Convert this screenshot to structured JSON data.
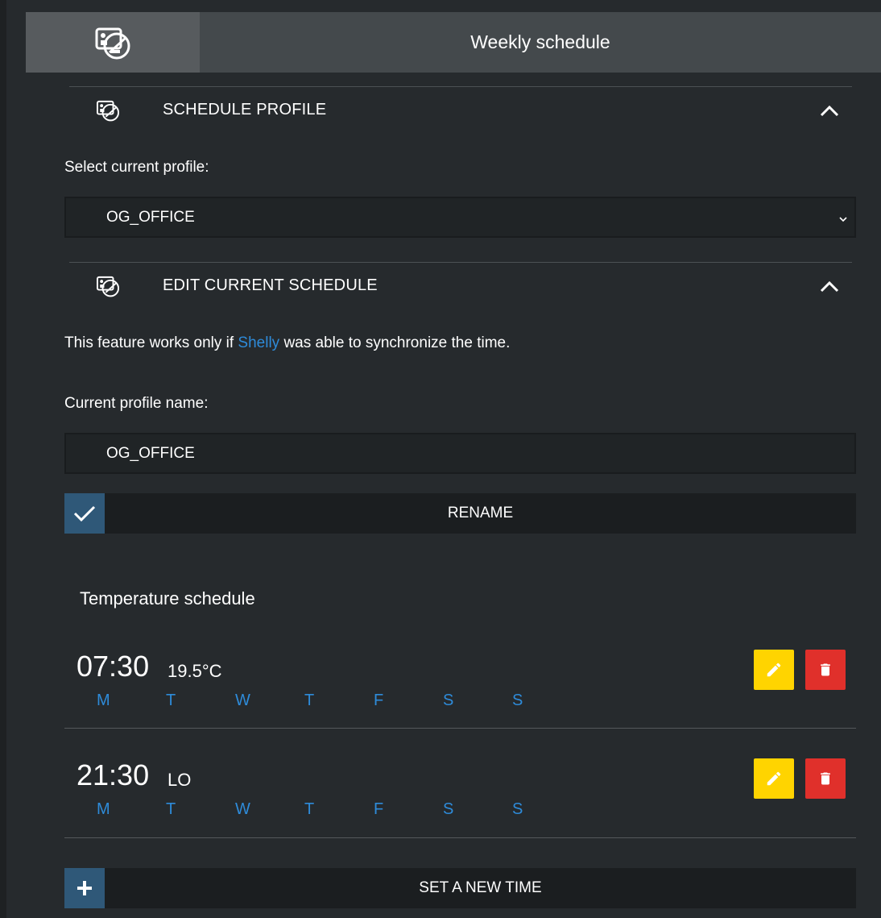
{
  "header": {
    "title": "Weekly schedule",
    "icon": "schedule-app-icon"
  },
  "schedule_profile": {
    "title": "SCHEDULE PROFILE",
    "select_label": "Select current profile:",
    "selected_profile": "OG_OFFICE"
  },
  "edit_schedule": {
    "title": "EDIT CURRENT SCHEDULE",
    "info_prefix": "This feature works only if ",
    "info_link": "Shelly",
    "info_suffix": " was able to synchronize the time.",
    "name_label": "Current profile name:",
    "name_value": "OG_OFFICE",
    "rename_label": "RENAME"
  },
  "temperature_schedule": {
    "title": "Temperature schedule",
    "entries": [
      {
        "time": "07:30",
        "value": "19.5°C",
        "days": [
          "M",
          "T",
          "W",
          "T",
          "F",
          "S",
          "S"
        ]
      },
      {
        "time": "21:30",
        "value": "LO",
        "days": [
          "M",
          "T",
          "W",
          "T",
          "F",
          "S",
          "S"
        ]
      }
    ],
    "new_time_label": "SET A NEW TIME"
  },
  "colors": {
    "background": "#262a2d",
    "accent_blue": "#2e8bd9",
    "edit_yellow": "#ffd400",
    "delete_red": "#e0302b",
    "icon_button_blue": "#2f5878"
  }
}
